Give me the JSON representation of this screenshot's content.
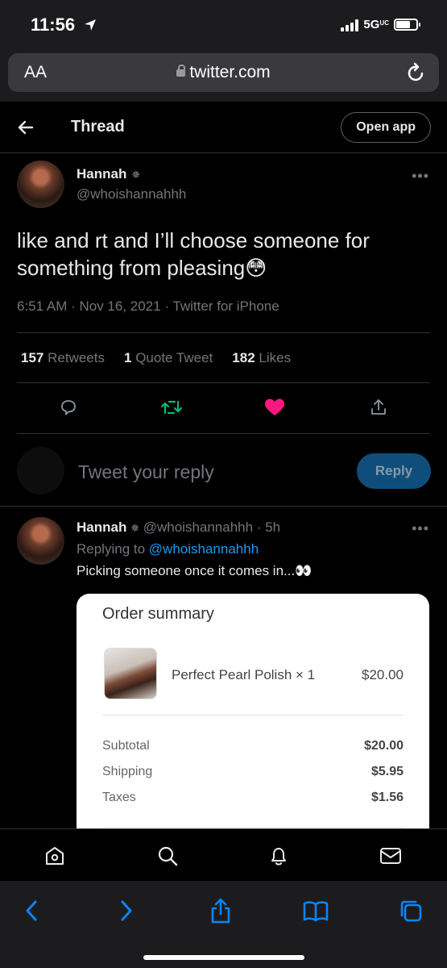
{
  "status_bar": {
    "time": "11:56",
    "network": "5G",
    "network_suffix": "UC"
  },
  "browser": {
    "text_size_label": "AA",
    "url": "twitter.com"
  },
  "header": {
    "title": "Thread",
    "open_app_label": "Open app"
  },
  "main_tweet": {
    "author_name": "Hannah",
    "author_name_mark": "✵",
    "author_handle": "@whoishannahhh",
    "text": "like and rt and I’ll choose someone for something from pleasing😳",
    "meta": "6:51 AM · Nov 16, 2021 · Twitter for iPhone",
    "stats": {
      "retweets_count": "157",
      "retweets_label": "Retweets",
      "quotes_count": "1",
      "quotes_label": "Quote Tweet",
      "likes_count": "182",
      "likes_label": "Likes"
    },
    "colors": {
      "retweet": "#00ba7c",
      "like": "#f91880"
    }
  },
  "reply_box": {
    "placeholder": "Tweet your reply",
    "button_label": "Reply"
  },
  "reply_tweet": {
    "author_name": "Hannah",
    "author_name_mark": "✵",
    "author_handle": "@whoishannahhh",
    "time": "· 5h",
    "replying_prefix": "Replying to",
    "replying_to": "@whoishannahhh",
    "text": "Picking someone once it comes in...👀"
  },
  "order_summary": {
    "title": "Order summary",
    "item_name": "Perfect Pearl Polish × 1",
    "item_price": "$20.00",
    "subtotal_label": "Subtotal",
    "subtotal_value": "$20.00",
    "shipping_label": "Shipping",
    "shipping_value": "$5.95",
    "taxes_label": "Taxes",
    "taxes_value": "$1.56"
  },
  "icons": {
    "twitter_nav": [
      "home-icon",
      "search-icon",
      "bell-icon",
      "mail-icon"
    ],
    "safari": [
      "back-icon",
      "forward-icon",
      "share-icon",
      "bookmarks-icon",
      "tabs-icon"
    ],
    "accent": "#1d9bf0"
  }
}
